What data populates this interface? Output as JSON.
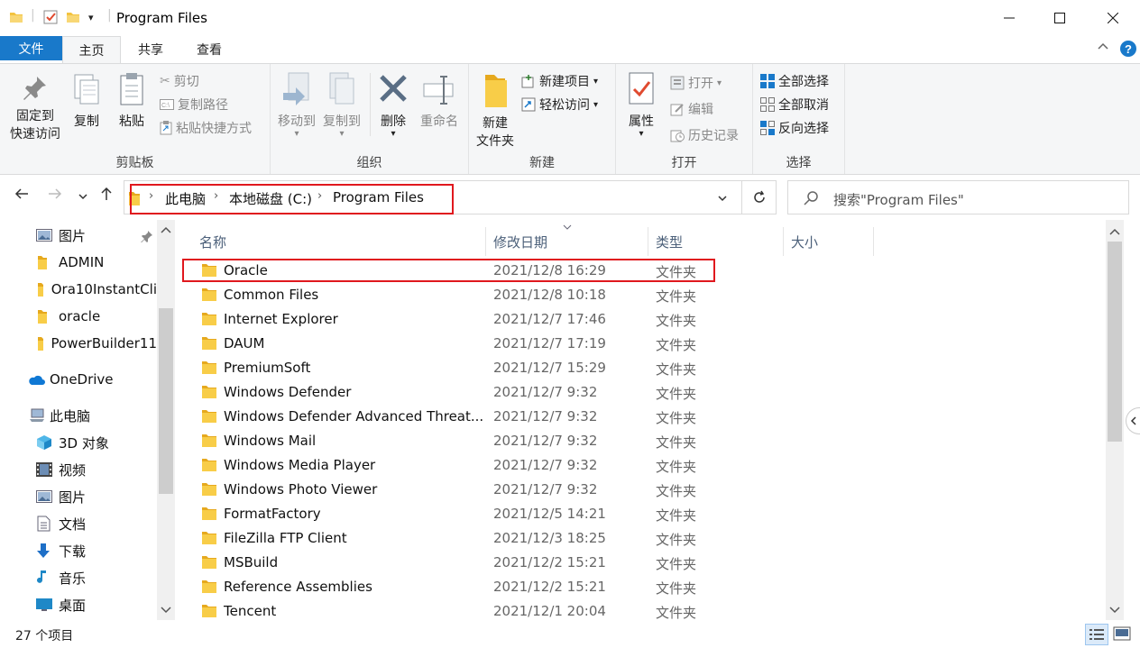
{
  "window": {
    "title": "Program Files"
  },
  "menu": {
    "file": "文件",
    "home": "主页",
    "share": "共享",
    "view": "查看"
  },
  "ribbon": {
    "clipboard": {
      "pin_l1": "固定到",
      "pin_l2": "快速访问",
      "copy": "复制",
      "paste": "粘贴",
      "cut": "剪切",
      "copy_path": "复制路径",
      "paste_shortcut": "粘贴快捷方式",
      "label": "剪贴板"
    },
    "organize": {
      "move_to": "移动到",
      "copy_to": "复制到",
      "delete": "删除",
      "rename": "重命名",
      "label": "组织"
    },
    "new": {
      "new_folder_l1": "新建",
      "new_folder_l2": "文件夹",
      "new_item": "新建项目",
      "easy_access": "轻松访问",
      "label": "新建"
    },
    "open": {
      "properties": "属性",
      "open": "打开",
      "edit": "编辑",
      "history": "历史记录",
      "label": "打开"
    },
    "select": {
      "select_all": "全部选择",
      "select_none": "全部取消",
      "invert": "反向选择",
      "label": "选择"
    }
  },
  "address": {
    "crumbs": [
      "此电脑",
      "本地磁盘 (C:)",
      "Program Files"
    ]
  },
  "search": {
    "placeholder": "搜索\"Program Files\""
  },
  "sidebar": {
    "items": [
      "图片",
      "ADMIN",
      "Ora10InstantCli",
      "oracle",
      "PowerBuilder11",
      "OneDrive",
      "此电脑",
      "3D 对象",
      "视频",
      "图片",
      "文档",
      "下载",
      "音乐",
      "桌面"
    ]
  },
  "columns": {
    "name": "名称",
    "date": "修改日期",
    "type": "类型",
    "size": "大小"
  },
  "files": [
    {
      "name": "Oracle",
      "date": "2021/12/8 16:29",
      "type": "文件夹"
    },
    {
      "name": "Common Files",
      "date": "2021/12/8 10:18",
      "type": "文件夹"
    },
    {
      "name": "Internet Explorer",
      "date": "2021/12/7 17:46",
      "type": "文件夹"
    },
    {
      "name": "DAUM",
      "date": "2021/12/7 17:19",
      "type": "文件夹"
    },
    {
      "name": "PremiumSoft",
      "date": "2021/12/7 15:29",
      "type": "文件夹"
    },
    {
      "name": "Windows Defender",
      "date": "2021/12/7 9:32",
      "type": "文件夹"
    },
    {
      "name": "Windows Defender Advanced Threat...",
      "date": "2021/12/7 9:32",
      "type": "文件夹"
    },
    {
      "name": "Windows Mail",
      "date": "2021/12/7 9:32",
      "type": "文件夹"
    },
    {
      "name": "Windows Media Player",
      "date": "2021/12/7 9:32",
      "type": "文件夹"
    },
    {
      "name": "Windows Photo Viewer",
      "date": "2021/12/7 9:32",
      "type": "文件夹"
    },
    {
      "name": "FormatFactory",
      "date": "2021/12/5 14:21",
      "type": "文件夹"
    },
    {
      "name": "FileZilla FTP Client",
      "date": "2021/12/3 18:25",
      "type": "文件夹"
    },
    {
      "name": "MSBuild",
      "date": "2021/12/2 15:21",
      "type": "文件夹"
    },
    {
      "name": "Reference Assemblies",
      "date": "2021/12/2 15:21",
      "type": "文件夹"
    },
    {
      "name": "Tencent",
      "date": "2021/12/1 20:04",
      "type": "文件夹"
    }
  ],
  "status": {
    "count": "27 个项目"
  },
  "colors": {
    "accent": "#1979ca",
    "highlight": "#e0181e",
    "folder": "#f3c33f"
  }
}
